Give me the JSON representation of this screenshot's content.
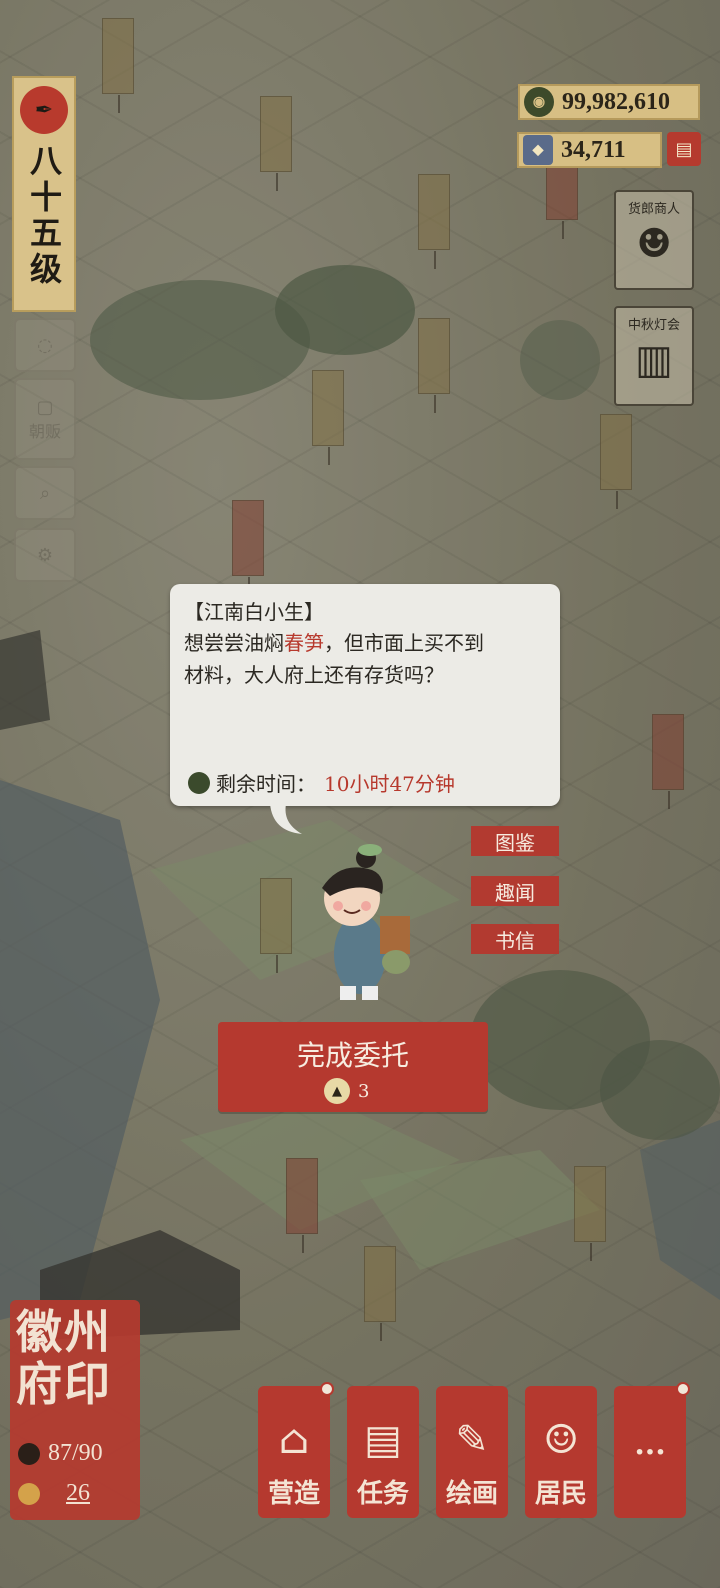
{
  "player": {
    "level": "八十五级"
  },
  "currency": {
    "coins": "99,982,610",
    "gems": "34,711"
  },
  "side_buttons": [
    {
      "label": ""
    },
    {
      "label": "朝贩"
    },
    {
      "label": ""
    },
    {
      "label": ""
    }
  ],
  "right_cards": [
    {
      "title": "货郎商人"
    },
    {
      "title": "中秋灯会"
    }
  ],
  "dialog": {
    "speaker": "【江南白小生】",
    "line1_before": "想尝尝油焖",
    "line1_highlight": "春笋",
    "line1_after": "，但市面上买不到",
    "line2": "材料，大人府上还有存货吗？",
    "timer_label": "剩余时间：",
    "timer_value": "10小时47分钟"
  },
  "tags": [
    {
      "label": "图鉴"
    },
    {
      "label": "趣闻"
    },
    {
      "label": "书信"
    }
  ],
  "complete_button": {
    "label": "完成委托",
    "cost": "3"
  },
  "seal": {
    "title": "徽州府印",
    "population": "87/90",
    "count": "26"
  },
  "bottom_nav": [
    {
      "label": "营造",
      "icon": "building-icon"
    },
    {
      "label": "任务",
      "icon": "book-icon"
    },
    {
      "label": "绘画",
      "icon": "scroll-icon"
    },
    {
      "label": "居民",
      "icon": "resident-icon"
    },
    {
      "label": "···",
      "icon": "more-icon"
    }
  ],
  "colors": {
    "accent_red": "#b5392f",
    "gold": "#d7bf84",
    "paper": "#ecebe6"
  }
}
